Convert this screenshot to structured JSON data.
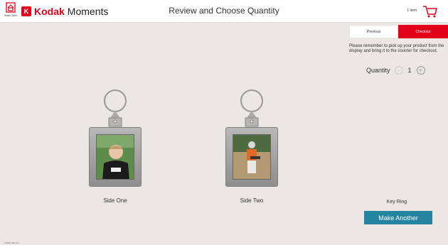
{
  "header": {
    "start_over_label": "Start Over",
    "brand_kodak": "Kodak",
    "brand_moments": "Moments",
    "title": "Review and Choose Quantity",
    "cart_count": "1 item"
  },
  "actions": {
    "previous_label": "Previous",
    "checkout_label": "Checkout"
  },
  "notice": "Please remember to pick up your product from the display and bring it to the counter for checkout.",
  "quantity": {
    "label": "Quantity",
    "value": "1",
    "minus_symbol": "−",
    "plus_symbol": "+"
  },
  "preview": {
    "side_one_label": "Side One",
    "side_two_label": "Side Two"
  },
  "product": {
    "name": "Key Ring",
    "make_another_label": "Make Another"
  },
  "colors": {
    "brand_red": "#e2001a",
    "accent_teal": "#2585a0",
    "background": "#ebe7e2"
  },
  "footer": {
    "text": "KIOSK Idle v2.1"
  }
}
